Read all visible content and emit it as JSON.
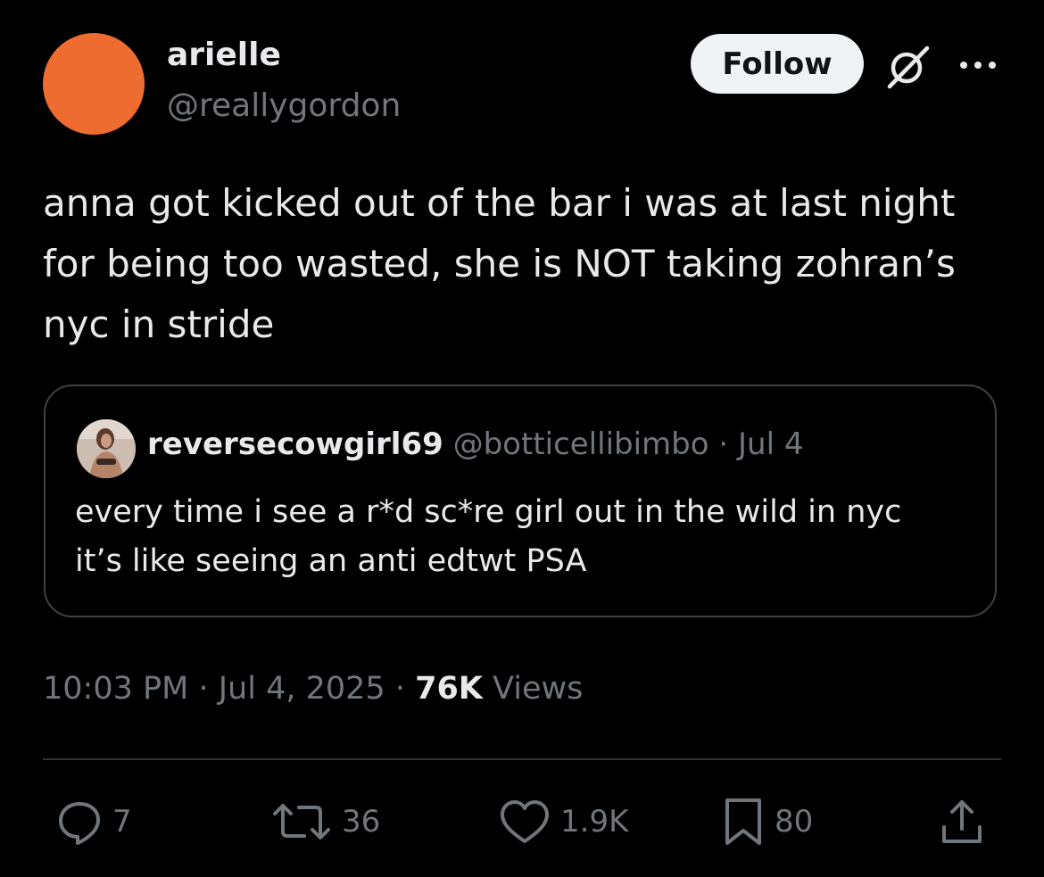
{
  "author": {
    "display_name": "arielle",
    "handle": "@reallygordon",
    "avatar_color": "#ee6c30"
  },
  "header_actions": {
    "follow_label": "Follow",
    "grok_icon": "grok-icon",
    "more_icon": "more-icon"
  },
  "tweet": {
    "text": "anna got kicked out of the bar i was at last night\nfor being too wasted, she is NOT taking zohran’s\nnyc in stride"
  },
  "quote": {
    "display_name": "reversecowgirl69",
    "handle": "@botticellibimbo",
    "separator": "·",
    "date": "Jul 4",
    "text": "every time i see a r*d sc*re girl out in the wild in nyc\nit’s like seeing an anti edtwt PSA"
  },
  "meta": {
    "time": "10:03 PM",
    "separator": "·",
    "date": "Jul 4, 2025",
    "views_count": "76K",
    "views_label": "Views"
  },
  "actions": {
    "replies": "7",
    "reposts": "36",
    "likes": "1.9K",
    "bookmarks": "80"
  },
  "colors": {
    "background": "#000000",
    "text_primary": "#e7e9ea",
    "text_secondary": "#71767b",
    "border": "#2f3336",
    "follow_bg": "#eff3f4",
    "follow_text": "#0f1419"
  }
}
